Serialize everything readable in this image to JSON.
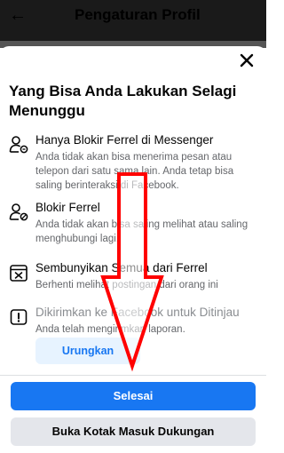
{
  "appbar": {
    "title": "Pengaturan Profil",
    "back_icon": "arrow-left-icon"
  },
  "sheet": {
    "heading": "Yang Bisa Anda Lakukan Selagi Menunggu",
    "close_icon": "close-icon",
    "items": [
      {
        "title": "Hanya Blokir Ferrel di Messenger",
        "description": "Anda tidak akan bisa menerima pesan atau telepon dari satu sama lain. Anda tetap bisa saling berinteraksi di Facebook.",
        "icon": "person-message-icon"
      },
      {
        "title": "Blokir Ferrel",
        "description": "Anda tidak akan bisa saling melihat atau saling menghubungi lagi.",
        "icon": "person-block-icon"
      },
      {
        "title": "Sembunyikan Semua dari Ferrel",
        "description": "Berhenti melihat postingan dari orang ini",
        "icon": "hide-icon"
      },
      {
        "title": "Dikirimkan ke Facebook untuk Ditinjau",
        "description": "Anda telah mengirimkan laporan.",
        "icon": "alert-icon"
      }
    ],
    "undo_label": "Urungkan",
    "done_label": "Selesai",
    "support_label": "Buka Kotak Masuk Dukungan"
  },
  "colors": {
    "accent": "#1877f2",
    "arrow": "#ff0000"
  }
}
